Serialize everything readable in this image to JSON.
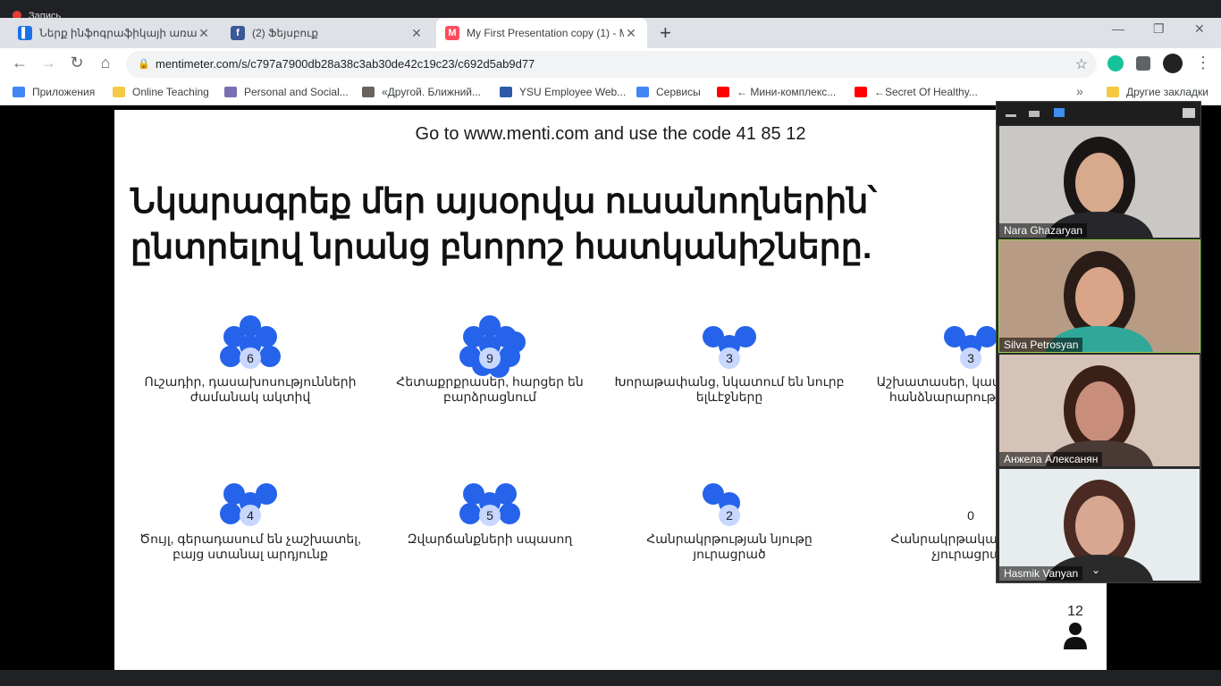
{
  "recording": {
    "label": "Запись"
  },
  "tabs": [
    {
      "title": "Ներք ինֆոգրաֆիկայի առավե",
      "color": "#1a73e8",
      "glyph": "▌"
    },
    {
      "title": "(2) Ֆեյսբուք",
      "color": "#3b5998",
      "glyph": "f"
    },
    {
      "title": "My First Presentation copy (1) - M",
      "color": "#ff4b5c",
      "glyph": "M"
    }
  ],
  "toolbar": {
    "url": "mentimeter.com/s/c797a7900db28a38c3ab30de42c19c23/c692d5ab9d77"
  },
  "bookmarks": [
    {
      "label": "Приложения",
      "color": "#4285f4"
    },
    {
      "label": "Online Teaching",
      "color": "#f6c945"
    },
    {
      "label": "Personal and Social...",
      "color": "#7a6fb0"
    },
    {
      "label": "«Другой. Ближний...",
      "color": "#6d6259"
    },
    {
      "label": "YSU Employee Web...",
      "color": "#2f5aa8"
    },
    {
      "label": "Сервисы",
      "color": "#4285f4"
    },
    {
      "label": "← Мини-комплекс...",
      "color": "#ff0000"
    },
    {
      "label": "←Secret Of Healthy...",
      "color": "#ff0000"
    },
    {
      "label": "Другие закладки",
      "color": "#f6c945"
    }
  ],
  "slide": {
    "code_text": "Go to www.menti.com and use the code 41 85 12",
    "question": "Նկարագրեք մեր այսօրվա ուսանողներին՝ ընտրելով նրանց բնորոշ հատկանիշները.",
    "participants": "12",
    "accent": "#2563eb",
    "options": [
      {
        "label": "Ուշադիր, դասախոսությունների ժամանակ ակտիվ",
        "count": "6",
        "n": 6
      },
      {
        "label": "Հետաքրքրասեր, հարցեր են բարձրացնում",
        "count": "9",
        "n": 9
      },
      {
        "label": "Խորաթափանց, նկատում են նուրբ ելևէջները",
        "count": "3",
        "n": 3
      },
      {
        "label": "Աշխատասեր, կատարում են հանձնարարությունները",
        "count": "3",
        "n": 3
      },
      {
        "label": "Ծույլ, գերադասում են չաշխատել, բայց ստանալ արդյունք",
        "count": "4",
        "n": 4
      },
      {
        "label": "Զվարճանքների սպասող",
        "count": "5",
        "n": 5
      },
      {
        "label": "Հանրակրթության նյութը յուրացրած",
        "count": "2",
        "n": 2
      },
      {
        "label": "Հանրակրթական նյութը չյուրացրած",
        "count": "0",
        "n": 0
      }
    ]
  },
  "zoom": {
    "participants": [
      {
        "name": "Nara Ghazaryan",
        "bg": "#c9c8c4",
        "skin": "#d7a98d",
        "hair": "#1b1616",
        "shirt": "#27262a"
      },
      {
        "name": "Silva Petrosyan",
        "bg": "#b89b84",
        "skin": "#d9a487",
        "hair": "#2a1d18",
        "shirt": "#2fa89a"
      },
      {
        "name": "Анжела Алексанян",
        "bg": "#d5c3b8",
        "skin": "#c98e7b",
        "hair": "#3b2018",
        "shirt": "#4a3a35"
      },
      {
        "name": "Hasmik Vanyan",
        "bg": "#e7ecee",
        "skin": "#d7a792",
        "hair": "#4a2a22",
        "shirt": "#2a2a2a"
      }
    ]
  }
}
